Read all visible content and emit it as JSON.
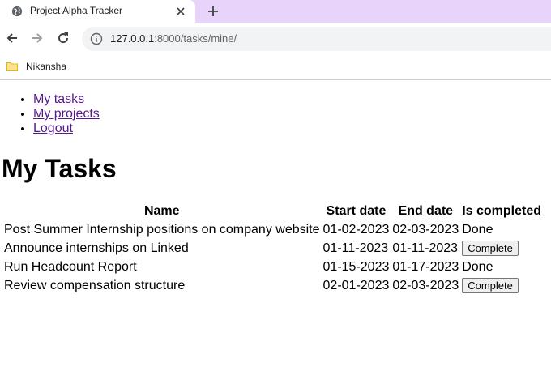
{
  "browser": {
    "tab_title": "Project Alpha Tracker",
    "url_host": "127.0.0.1",
    "url_path": ":8000/tasks/mine/",
    "bookmark_label": "Nikansha",
    "tabbar_color": "#e8d3fb"
  },
  "nav": {
    "links": [
      {
        "label": "My tasks"
      },
      {
        "label": "My projects"
      },
      {
        "label": "Logout"
      }
    ],
    "link_color": "#551a8b"
  },
  "page": {
    "title": "My Tasks"
  },
  "table": {
    "headers": {
      "name": "Name",
      "start": "Start date",
      "end": "End date",
      "completed": "Is completed"
    },
    "rows": [
      {
        "name": "Post Summer Internship positions on company website",
        "start": "01-02-2023",
        "end": "02-03-2023",
        "status": "Done",
        "button": null
      },
      {
        "name": "Announce internships on Linked",
        "start": "01-11-2023",
        "end": "01-11-2023",
        "status": null,
        "button": "Complete"
      },
      {
        "name": "Run Headcount Report",
        "start": "01-15-2023",
        "end": "01-17-2023",
        "status": "Done",
        "button": null
      },
      {
        "name": "Review compensation structure",
        "start": "02-01-2023",
        "end": "02-03-2023",
        "status": null,
        "button": "Complete"
      }
    ]
  }
}
